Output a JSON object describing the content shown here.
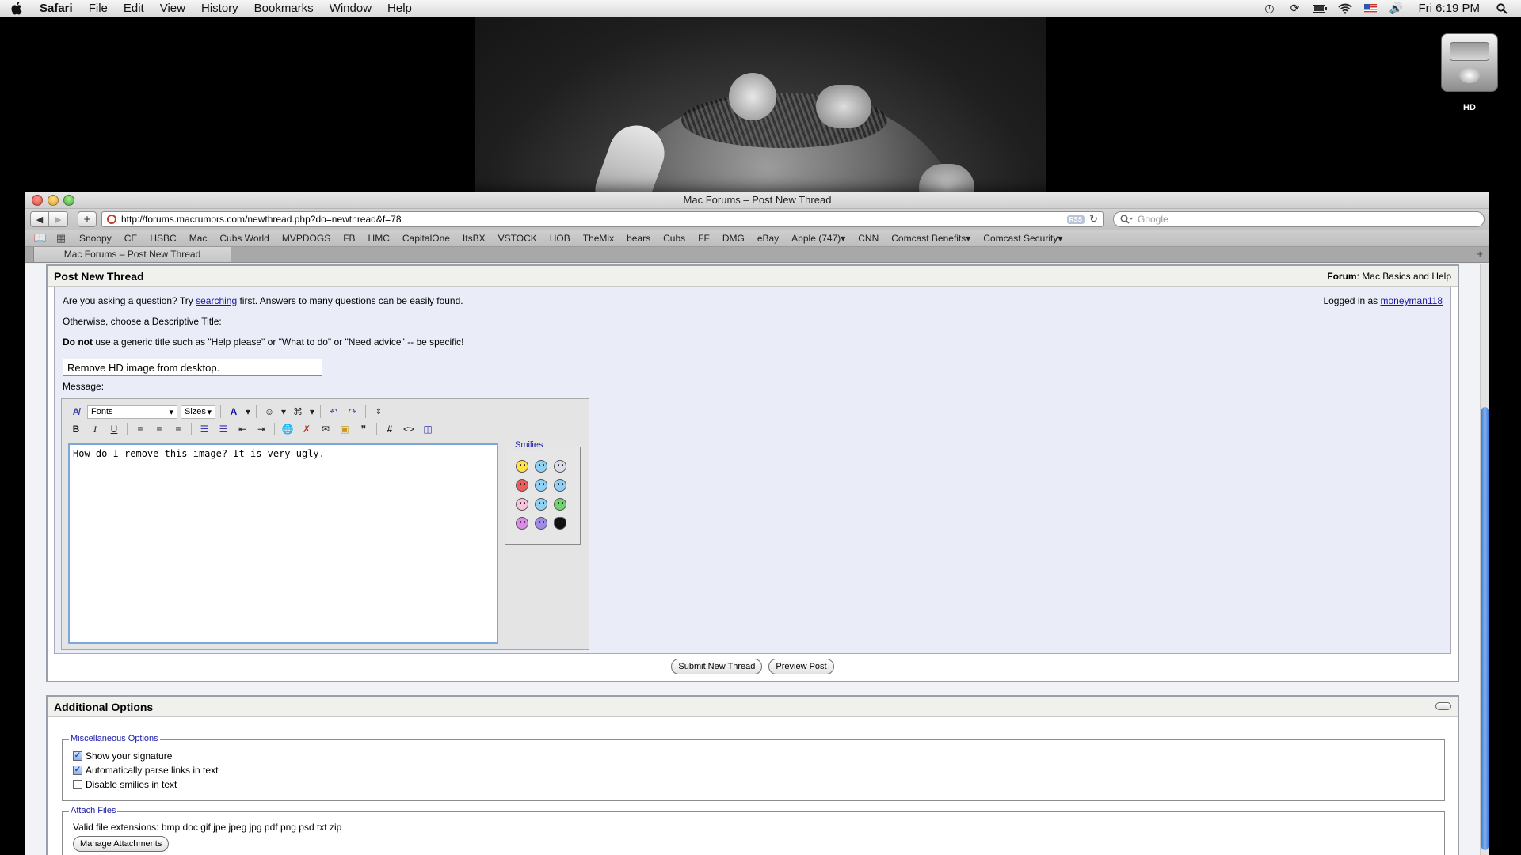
{
  "menubar": {
    "app": "Safari",
    "items": [
      "File",
      "Edit",
      "View",
      "History",
      "Bookmarks",
      "Window",
      "Help"
    ],
    "clock": "Fri 6:19 PM",
    "status_icons": [
      "time-machine-icon",
      "sync-icon",
      "battery-icon",
      "wifi-icon",
      "flag-icon",
      "volume-icon",
      "spotlight-icon"
    ]
  },
  "desktop": {
    "drive_label": "HD"
  },
  "window": {
    "title": "Mac Forums – Post New Thread",
    "url": "http://forums.macrumors.com/newthread.php?do=newthread&f=78",
    "rss": "RSS",
    "search_placeholder": "Google",
    "tab_title": "Mac Forums – Post New Thread",
    "bookmarks": [
      "Snoopy",
      "CE",
      "HSBC",
      "Mac",
      "Cubs World",
      "MVPDOGS",
      "FB",
      "HMC",
      "CapitalOne",
      "ItsBX",
      "VSTOCK",
      "HOB",
      "TheMix",
      "bears",
      "Cubs",
      "FF",
      "DMG",
      "eBay",
      "Apple (747)▾",
      "CNN",
      "Comcast Benefits▾",
      "Comcast Security▾"
    ]
  },
  "post": {
    "heading": "Post New Thread",
    "forum_label": "Forum",
    "forum_name": ": Mac Basics and Help",
    "question_pre": "Are you asking a question? Try ",
    "question_link": "searching",
    "question_post": " first. Answers to many questions can be easily found.",
    "otherwise": "Otherwise, choose a Descriptive Title:",
    "donot_bold": "Do not",
    "donot_rest": " use a generic title such as \"Help please\" or \"What to do\" or \"Need advice\" -- be specific!",
    "logged_in_label": "Logged in as ",
    "username": "moneyman118",
    "title_value": "Remove HD image from desktop.",
    "message_label": "Message:",
    "fonts_label": "Fonts",
    "sizes_label": "Sizes",
    "message_text": "How do I remove this image? It is very ugly.",
    "smilies_label": "Smilies",
    "submit_label": "Submit New Thread",
    "preview_label": "Preview Post"
  },
  "options": {
    "heading": "Additional Options",
    "misc_legend": "Miscellaneous Options",
    "checks": [
      {
        "label": "Show your signature",
        "checked": true
      },
      {
        "label": "Automatically parse links in text",
        "checked": true
      },
      {
        "label": "Disable smilies in text",
        "checked": false
      }
    ],
    "attach_legend": "Attach Files",
    "extensions": "Valid file extensions: bmp doc gif jpe jpeg jpg pdf png psd txt zip",
    "manage_label": "Manage Attachments"
  }
}
